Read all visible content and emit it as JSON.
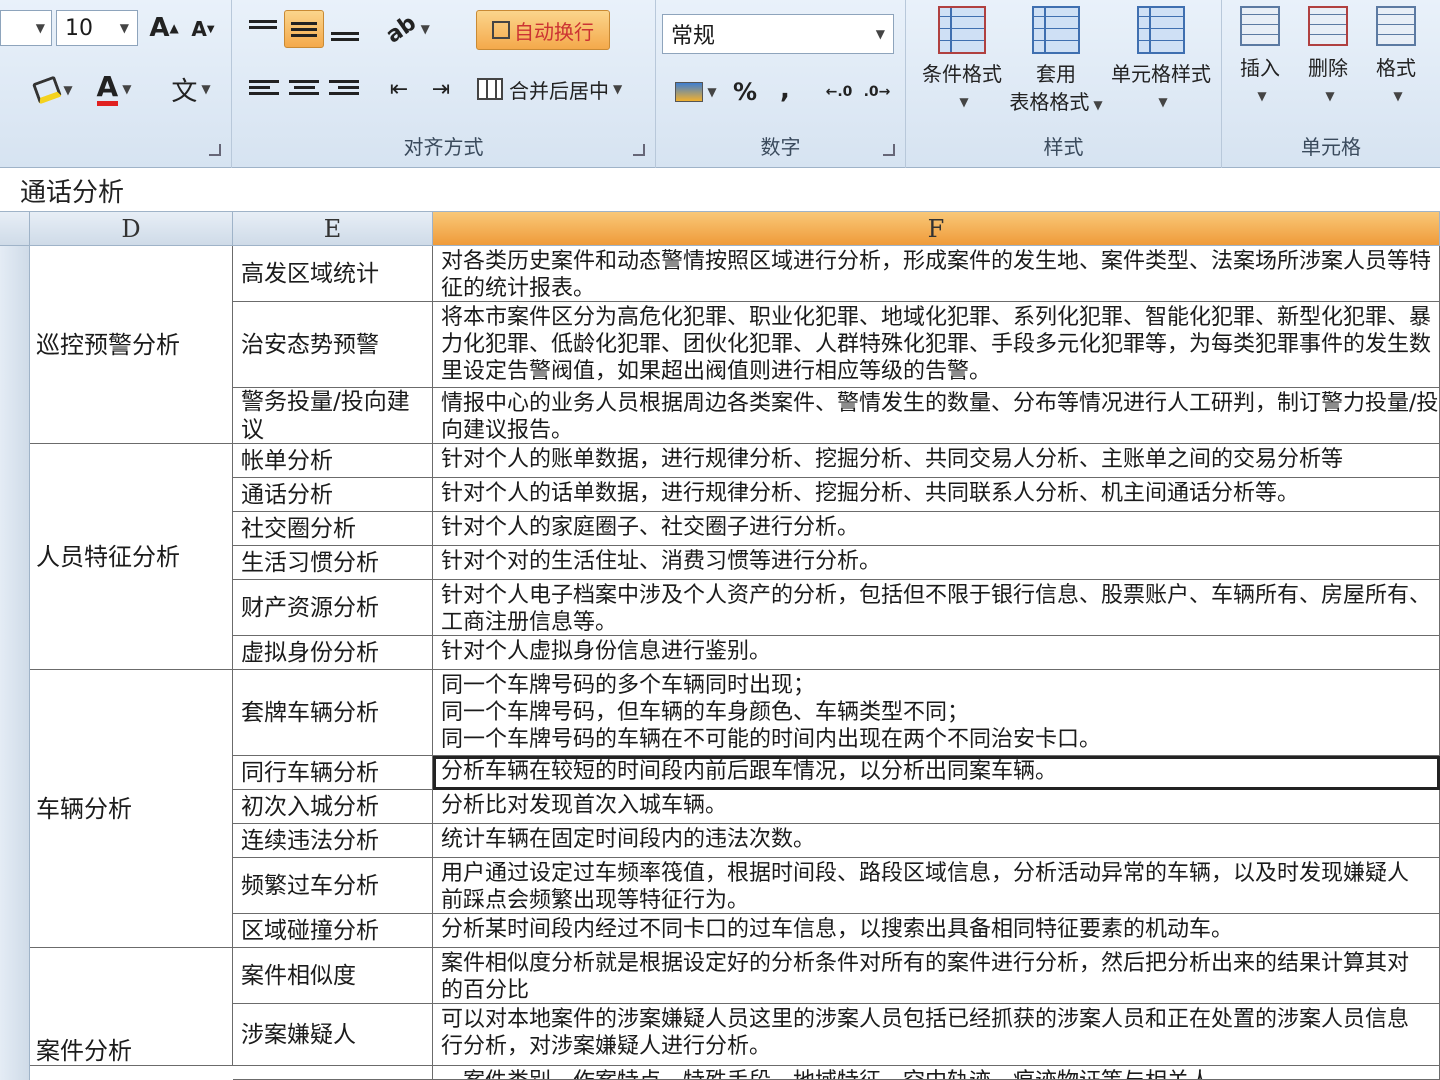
{
  "ribbon": {
    "font": {
      "size": "10",
      "grow_icon": "A",
      "shrink_icon": "A",
      "font_color_icon": "A",
      "pinyin_icon": "文"
    },
    "alignment": {
      "wrap_text": "自动换行",
      "merge_center": "合并后居中",
      "label": "对齐方式"
    },
    "number": {
      "format": "常规",
      "percent": "%",
      "comma": ",",
      "label": "数字"
    },
    "styles": {
      "conditional": "条件格式",
      "table_format_1": "套用",
      "table_format_2": "表格格式",
      "cell_styles": "单元格样式",
      "label": "样式"
    },
    "cells": {
      "insert": "插入",
      "delete": "删除",
      "format": "格式",
      "label": "单元格"
    }
  },
  "formula_bar": {
    "content": "通话分析"
  },
  "columns": [
    "D",
    "E",
    "F"
  ],
  "rows": [
    {
      "feature": "高发区域统计",
      "desc": [
        "对各类历史案件和动态警情按照区域进行分析，形成案件的发生地、案件类型、法案场所涉案人员等特",
        "征的统计报表。"
      ]
    },
    {
      "feature": "治安态势预警",
      "desc": [
        "将本市案件区分为高危化犯罪、职业化犯罪、地域化犯罪、系列化犯罪、智能化犯罪、新型化犯罪、暴",
        "力化犯罪、低龄化犯罪、团伙化犯罪、人群特殊化犯罪、手段多元化犯罪等，为每类犯罪事件的发生数",
        "里设定告警阀值，如果超出阀值则进行相应等级的告警。"
      ]
    },
    {
      "feature": "警务投量/投向建议",
      "desc": [
        "情报中心的业务人员根据周边各类案件、警情发生的数量、分布等情况进行人工研判，制订警力投量/投",
        "向建议报告。"
      ]
    },
    {
      "feature": "帐单分析",
      "desc": [
        "针对个人的账单数据，进行规律分析、挖掘分析、共同交易人分析、主账单之间的交易分析等"
      ]
    },
    {
      "feature": "通话分析",
      "desc": [
        "针对个人的话单数据，进行规律分析、挖掘分析、共同联系人分析、机主间通话分析等。"
      ]
    },
    {
      "feature": "社交圈分析",
      "desc": [
        "针对个人的家庭圈子、社交圈子进行分析。"
      ]
    },
    {
      "feature": "生活习惯分析",
      "desc": [
        "针对个对的生活住址、消费习惯等进行分析。"
      ]
    },
    {
      "feature": "财产资源分析",
      "desc": [
        "针对个人电子档案中涉及个人资产的分析，包括但不限于银行信息、股票账户、车辆所有、房屋所有、",
        "工商注册信息等。"
      ]
    },
    {
      "feature": "虚拟身份分析",
      "desc": [
        "针对个人虚拟身份信息进行鉴别。"
      ]
    },
    {
      "feature": "套牌车辆分析",
      "desc": [
        "同一个车牌号码的多个车辆同时出现；",
        "同一个车牌号码，但车辆的车身颜色、车辆类型不同；",
        "同一个车牌号码的车辆在不可能的时间内出现在两个不同治安卡口。"
      ]
    },
    {
      "feature": "同行车辆分析",
      "desc": [
        "分析车辆在较短的时间段内前后跟车情况，以分析出同案车辆。"
      ]
    },
    {
      "feature": "初次入城分析",
      "desc": [
        "分析比对发现首次入城车辆。"
      ]
    },
    {
      "feature": "连续违法分析",
      "desc": [
        "统计车辆在固定时间段内的违法次数。"
      ]
    },
    {
      "feature": "频繁过车分析",
      "desc": [
        "用户通过设定过车频率筏值，根据时间段、路段区域信息，分析活动异常的车辆，以及时发现嫌疑人",
        "前踩点会频繁出现等特征行为。"
      ]
    },
    {
      "feature": "区域碰撞分析",
      "desc": [
        "分析某时间段内经过不同卡口的过车信息，以搜索出具备相同特征要素的机动车。"
      ]
    },
    {
      "feature": "案件相似度",
      "desc": [
        "案件相似度分析就是根据设定好的分析条件对所有的案件进行分析，然后把分析出来的结果计算其对",
        "的百分比"
      ]
    },
    {
      "feature": "涉案嫌疑人",
      "desc": [
        "可以对本地案件的涉案嫌疑人员这里的涉案人员包括已经抓获的涉案人员和正在处置的涉案人员信息",
        "行分析，对涉案嫌疑人进行分析。"
      ]
    }
  ],
  "categories": [
    "巡控预警分析",
    "人员特征分析",
    "车辆分析",
    "案件分析"
  ],
  "partial_bottom_text": "，案件类别、作案特点、特殊手段、地域特征、空中轨迹、痕迹物证等与相关人"
}
